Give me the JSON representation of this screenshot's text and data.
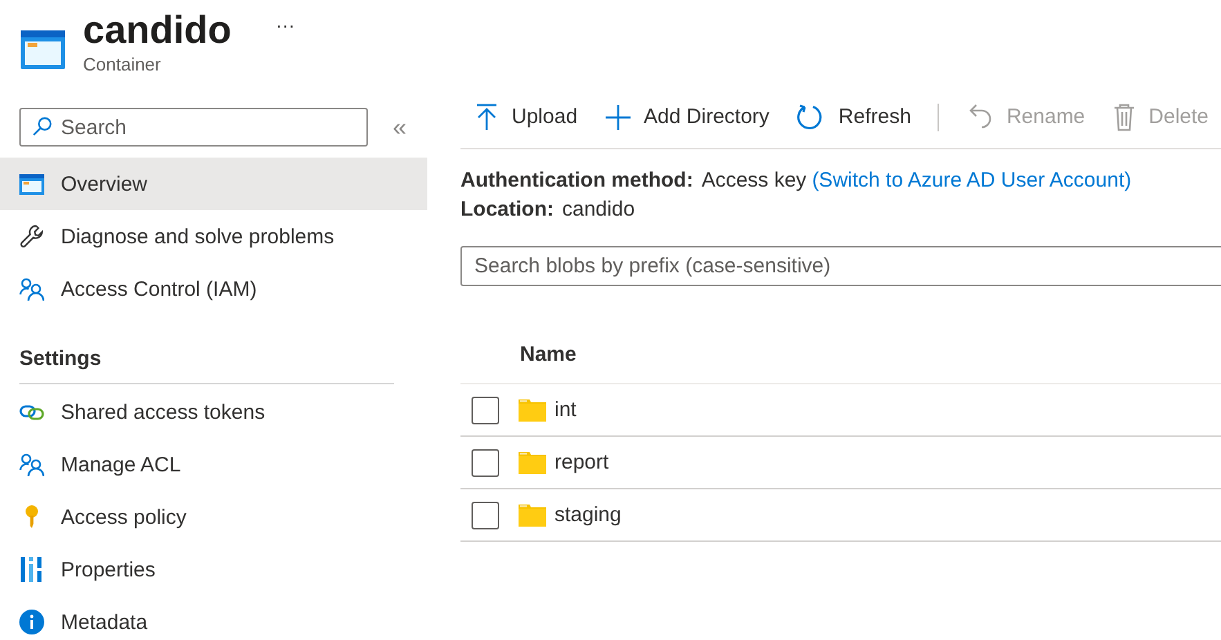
{
  "header": {
    "title": "candido",
    "subtitle": "Container",
    "more": "···"
  },
  "sidebar": {
    "search": {
      "placeholder": "Search"
    },
    "collapse": "«",
    "items": [
      {
        "label": "Overview",
        "selected": true
      },
      {
        "label": "Diagnose and solve problems",
        "selected": false
      },
      {
        "label": "Access Control (IAM)",
        "selected": false
      }
    ],
    "sections": [
      {
        "title": "Settings",
        "items": [
          {
            "label": "Shared access tokens",
            "selected": false
          },
          {
            "label": "Manage ACL",
            "selected": false
          },
          {
            "label": "Access policy",
            "selected": false
          },
          {
            "label": "Properties",
            "selected": false
          },
          {
            "label": "Metadata",
            "selected": false
          }
        ]
      }
    ]
  },
  "toolbar": [
    {
      "label": "Upload",
      "disabled": false,
      "separator_after": false
    },
    {
      "label": "Add Directory",
      "disabled": false,
      "separator_after": false
    },
    {
      "label": "Refresh",
      "disabled": false,
      "separator_after": true
    },
    {
      "label": "Rename",
      "disabled": true,
      "separator_after": false
    },
    {
      "label": "Delete",
      "disabled": true,
      "separator_after": false
    }
  ],
  "info": [
    {
      "label": "Authentication method:",
      "value": "Access key",
      "link": "(Switch to Azure AD User Account)"
    },
    {
      "label": "Location:",
      "value": "candido"
    }
  ],
  "blob_search": {
    "placeholder": "Search blobs by prefix (case-sensitive)"
  },
  "table": {
    "columns": [
      "Name"
    ],
    "rows": [
      {
        "name": "int",
        "checked": false
      },
      {
        "name": "report",
        "checked": false
      },
      {
        "name": "staging",
        "checked": false
      }
    ]
  }
}
